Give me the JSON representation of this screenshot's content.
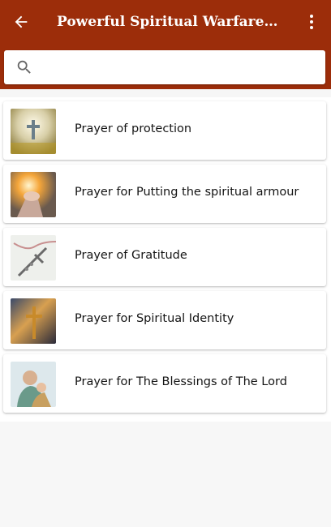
{
  "app_bar": {
    "title": "Powerful Spiritual Warfare Prayers t...",
    "back_icon": "arrow-back-icon",
    "menu_icon": "more-vert-icon",
    "color": "#9c2d0a"
  },
  "search": {
    "icon": "search-icon",
    "value": "",
    "placeholder": ""
  },
  "prayers": [
    {
      "label": "Prayer of protection",
      "thumbnail": "cross-sky-image"
    },
    {
      "label": "Prayer for Putting the spiritual armour",
      "thumbnail": "hand-sunlight-image"
    },
    {
      "label": "Prayer of Gratitude",
      "thumbnail": "rosary-image"
    },
    {
      "label": "Prayer for Spiritual Identity",
      "thumbnail": "crucifix-light-image"
    },
    {
      "label": "Prayer for The Blessings of The Lord",
      "thumbnail": "saint-joseph-image"
    }
  ]
}
